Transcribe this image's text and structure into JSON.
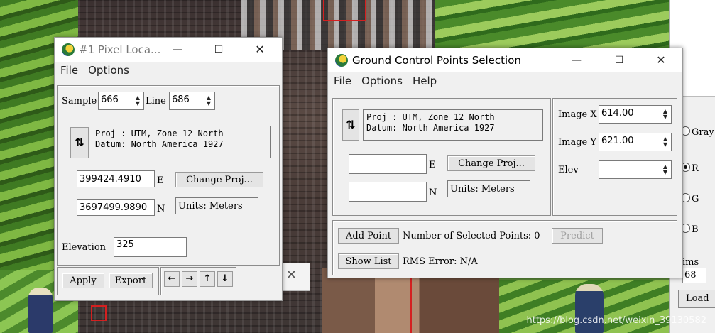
{
  "pixel_locator": {
    "title": "#1 Pixel Loca...",
    "menu": [
      "File",
      "Options"
    ],
    "sample_label": "Sample",
    "sample_value": "666",
    "line_label": "Line",
    "line_value": "686",
    "proj_line1": "Proj : UTM, Zone 12 North",
    "proj_line2": "Datum: North America 1927",
    "easting_value": "399424.4910",
    "easting_label": "E",
    "northing_value": "3697499.9890",
    "northing_label": "N",
    "change_proj": "Change Proj...",
    "units": "Units: Meters",
    "elevation_label": "Elevation",
    "elevation_value": "325",
    "apply": "Apply",
    "export": "Export",
    "arrows": [
      "←",
      "→",
      "↑",
      "↓"
    ]
  },
  "gcp": {
    "title": "Ground Control Points Selection",
    "menu": [
      "File",
      "Options",
      "Help"
    ],
    "proj_line1": "Proj : UTM, Zone 12 North",
    "proj_line2": "Datum: North America 1927",
    "e_label": "E",
    "n_label": "N",
    "e_value": "",
    "n_value": "",
    "change_proj": "Change Proj...",
    "units": "Units: Meters",
    "image_x_label": "Image X",
    "image_x_value": "614.00",
    "image_y_label": "Image Y",
    "image_y_value": "621.00",
    "elev_label": "Elev",
    "elev_value": "",
    "add_point": "Add Point",
    "num_selected": "Number of Selected Points: 0",
    "predict": "Predict",
    "show_list": "Show List",
    "rms_error": "RMS Error: N/A"
  },
  "right_panel": {
    "gray": "Gray",
    "r": "R",
    "g": "G",
    "b": "B",
    "ims_label": "ims",
    "ims_value": "68",
    "load": "Load"
  },
  "watermark": "https://blog.csdn.net/weixin_39130582"
}
